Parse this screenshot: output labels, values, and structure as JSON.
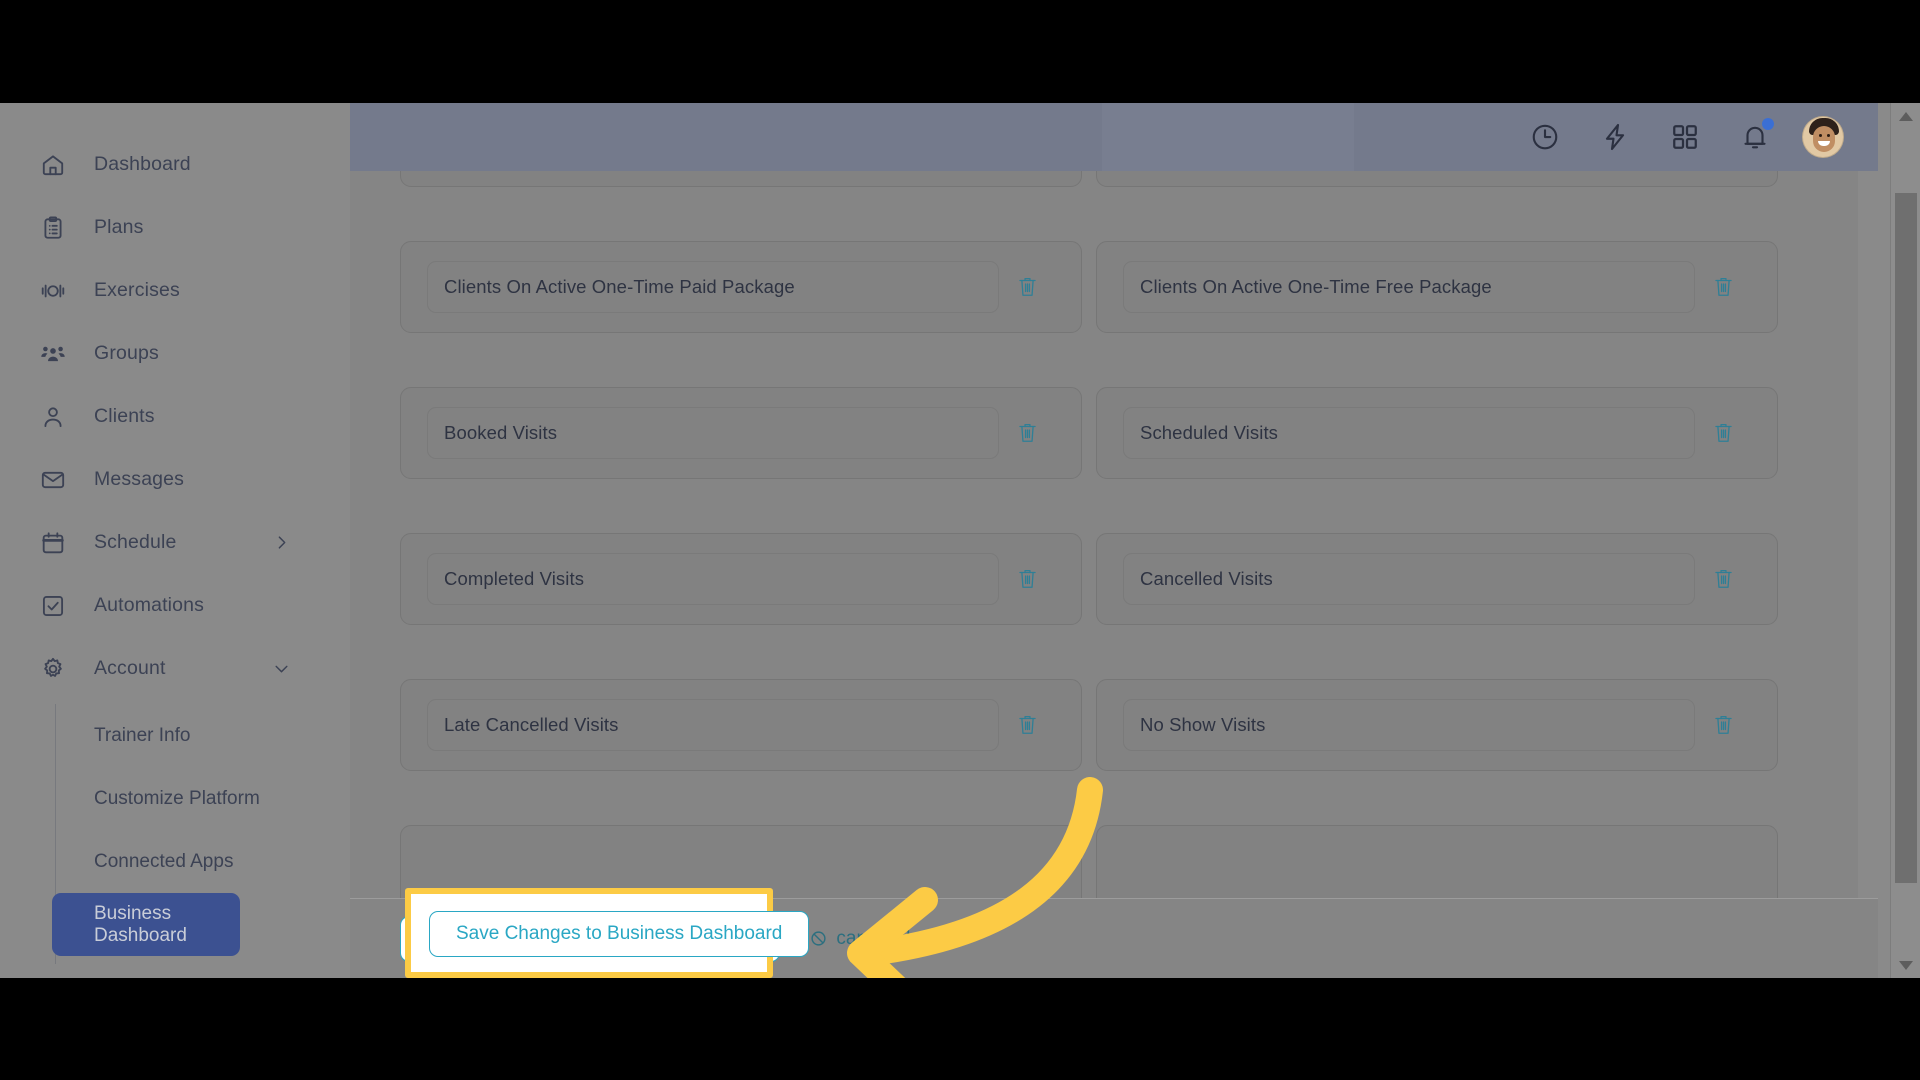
{
  "app": {
    "sidebar": {
      "items": [
        {
          "label": "Dashboard",
          "icon": "home-icon",
          "chevron": null
        },
        {
          "label": "Plans",
          "icon": "clipboard-icon",
          "chevron": null
        },
        {
          "label": "Exercises",
          "icon": "dumbbell-icon",
          "chevron": null
        },
        {
          "label": "Groups",
          "icon": "group-icon",
          "chevron": null
        },
        {
          "label": "Clients",
          "icon": "person-icon",
          "chevron": null
        },
        {
          "label": "Messages",
          "icon": "envelope-icon",
          "chevron": null
        },
        {
          "label": "Schedule",
          "icon": "calendar-icon",
          "chevron": "chevron-right-icon"
        },
        {
          "label": "Automations",
          "icon": "checkbox-icon",
          "chevron": null
        },
        {
          "label": "Account",
          "icon": "gear-icon",
          "chevron": "chevron-down-icon"
        }
      ],
      "subitems": [
        {
          "label": "Trainer Info",
          "active": false
        },
        {
          "label": "Customize Platform",
          "active": false
        },
        {
          "label": "Connected Apps",
          "active": false
        },
        {
          "label": "Business Dashboard",
          "active": true
        }
      ],
      "active_color": "#3c5191"
    },
    "header": {
      "icons": [
        {
          "name": "clock-icon"
        },
        {
          "name": "lightning-bolt-icon"
        },
        {
          "name": "grid-apps-icon"
        },
        {
          "name": "bell-icon",
          "badge": true
        }
      ],
      "avatar": "user-avatar",
      "badge_color": "#3b6fd4"
    },
    "content": {
      "rows": [
        {
          "left": {
            "value": "Clients On Active One-Time Paid Package",
            "delete": "delete-icon"
          },
          "right": {
            "value": "Clients On Active One-Time Free Package",
            "delete": "delete-icon"
          }
        },
        {
          "left": {
            "value": "Booked Visits",
            "delete": "delete-icon"
          },
          "right": {
            "value": "Scheduled Visits",
            "delete": "delete-icon"
          }
        },
        {
          "left": {
            "value": "Completed Visits",
            "delete": "delete-icon"
          },
          "right": {
            "value": "Cancelled Visits",
            "delete": "delete-icon"
          }
        },
        {
          "left": {
            "value": "Late Cancelled Visits",
            "delete": "delete-icon"
          },
          "right": {
            "value": "No Show Visits",
            "delete": "delete-icon"
          }
        }
      ]
    },
    "savebar": {
      "save_label": "Save Changes to Business Dashboard",
      "cancel_label": "cancel changes",
      "cancel_icon": "no-entry-icon",
      "accent_color": "#2aa7c4"
    },
    "annotation": {
      "highlight_color": "#fccb45",
      "arrow_color": "#fccb45",
      "highlighted_element": "save-changes-to-business-dashboard-button"
    }
  }
}
